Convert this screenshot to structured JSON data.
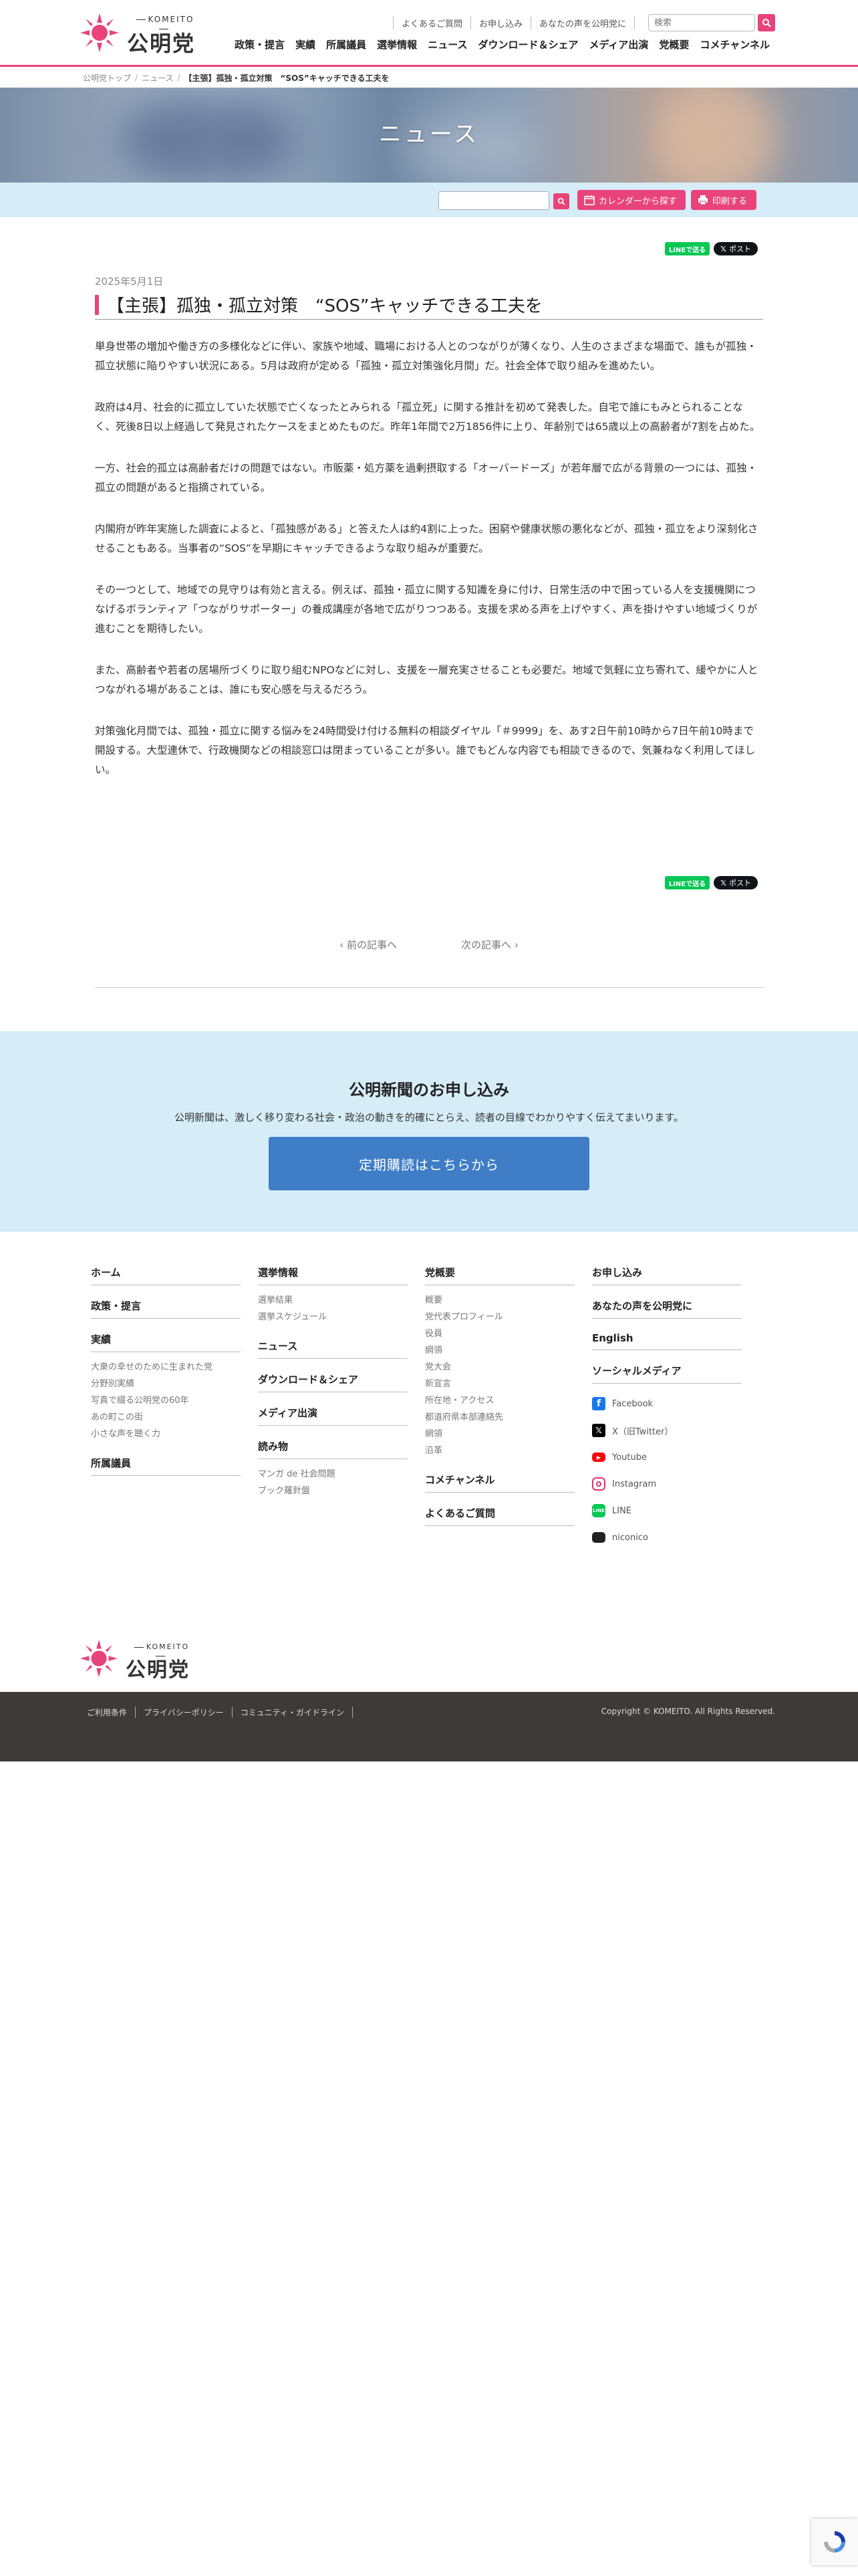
{
  "header": {
    "brand_en": "KOMEITO",
    "brand_ja": "公明党",
    "util_links": [
      "よくあるご質問",
      "お申し込み",
      "あなたの声を公明党に"
    ],
    "search_placeholder": "検索",
    "nav": [
      "政策・提言",
      "実績",
      "所属議員",
      "選挙情報",
      "ニュース",
      "ダウンロード＆シェア",
      "メディア出演",
      "党概要",
      "コメチャンネル"
    ]
  },
  "breadcrumb": {
    "home": "公明党トップ",
    "section": "ニュース",
    "current": "【主張】孤独・孤立対策　“SOS”キャッチできる工夫を"
  },
  "hero": {
    "title": "ニュース"
  },
  "toolbar": {
    "calendar_label": "カレンダーから探す",
    "print_label": "印刷する"
  },
  "share": {
    "line_label": "LINEで送る",
    "x_label": "ポスト"
  },
  "article": {
    "date": "2025年5月1日",
    "title": "【主張】孤独・孤立対策　“SOS”キャッチできる工夫を",
    "paragraphs": [
      "単身世帯の増加や働き方の多様化などに伴い、家族や地域、職場における人とのつながりが薄くなり、人生のさまざまな場面で、誰もが孤独・孤立状態に陥りやすい状況にある。5月は政府が定める「孤独・孤立対策強化月間」だ。社会全体で取り組みを進めたい。",
      "政府は4月、社会的に孤立していた状態で亡くなったとみられる「孤立死」に関する推計を初めて発表した。自宅で誰にもみとられることなく、死後8日以上経過して発見されたケースをまとめたものだ。昨年1年間で2万1856件に上り、年齢別では65歳以上の高齢者が7割を占めた。",
      "一方、社会的孤立は高齢者だけの問題ではない。市販薬・処方薬を過剰摂取する「オーバードーズ」が若年層で広がる背景の一つには、孤独・孤立の問題があると指摘されている。",
      "内閣府が昨年実施した調査によると、「孤独感がある」と答えた人は約4割に上った。困窮や健康状態の悪化などが、孤独・孤立をより深刻化させることもある。当事者の“SOS”を早期にキャッチできるような取り組みが重要だ。",
      "その一つとして、地域での見守りは有効と言える。例えば、孤独・孤立に関する知識を身に付け、日常生活の中で困っている人を支援機関につなげるボランティア「つながりサポーター」の養成講座が各地で広がりつつある。支援を求める声を上げやすく、声を掛けやすい地域づくりが進むことを期待したい。",
      "また、高齢者や若者の居場所づくりに取り組むNPOなどに対し、支援を一層充実させることも必要だ。地域で気軽に立ち寄れて、緩やかに人とつながれる場があることは、誰にも安心感を与えるだろう。",
      "対策強化月間では、孤独・孤立に関する悩みを24時間受け付ける無料の相談ダイヤル「＃9999」を、あす2日午前10時から7日午前10時まで開設する。大型連休で、行政機関などの相談窓口は閉まっていることが多い。誰でもどんな内容でも相談できるので、気兼ねなく利用してほしい。"
    ]
  },
  "pager": {
    "prev": "前の記事へ",
    "next": "次の記事へ"
  },
  "subscribe": {
    "title": "公明新聞のお申し込み",
    "description": "公明新聞は、激しく移り変わる社会・政治の動きを的確にとらえ、読者の目線でわかりやすく伝えてまいります。",
    "cta": "定期購読はこちらから"
  },
  "footer": {
    "col1": [
      {
        "head": "ホーム",
        "items": []
      },
      {
        "head": "政策・提言",
        "items": []
      },
      {
        "head": "実績",
        "items": [
          "大衆の幸せのために生まれた党",
          "分野別実績",
          "写真で綴る公明党の60年",
          "あの町この街",
          "小さな声を聴く力"
        ]
      },
      {
        "head": "所属議員",
        "items": []
      }
    ],
    "col2": [
      {
        "head": "選挙情報",
        "items": [
          "選挙結果",
          "選挙スケジュール"
        ]
      },
      {
        "head": "ニュース",
        "items": []
      },
      {
        "head": "ダウンロード＆シェア",
        "items": []
      },
      {
        "head": "メディア出演",
        "items": []
      },
      {
        "head": "読み物",
        "items": [
          "マンガ de 社会問題",
          "ブック羅針盤"
        ]
      }
    ],
    "col3": [
      {
        "head": "党概要",
        "items": [
          "概要",
          "党代表プロフィール",
          "役員",
          "綱領",
          "党大会",
          "新宣言",
          "所在地・アクセス",
          "都道府県本部連絡先",
          "網領",
          "沿革"
        ]
      },
      {
        "head": "コメチャンネル",
        "items": []
      },
      {
        "head": "よくあるご質問",
        "items": []
      }
    ],
    "col4": [
      {
        "head": "お申し込み",
        "items": []
      },
      {
        "head": "あなたの声を公明党に",
        "items": []
      },
      {
        "head": "English",
        "items": []
      }
    ],
    "social_head": "ソーシャルメディア",
    "social": [
      {
        "label": "Facebook",
        "icon": "facebook-icon",
        "color": "#1877f2"
      },
      {
        "label": "X（旧Twitter）",
        "icon": "x-icon",
        "color": "#000000"
      },
      {
        "label": "Youtube",
        "icon": "youtube-icon",
        "color": "#ff0000"
      },
      {
        "label": "Instagram",
        "icon": "instagram-icon",
        "color": "#e1306c"
      },
      {
        "label": "LINE",
        "icon": "line-icon",
        "color": "#06c755"
      },
      {
        "label": "niconico",
        "icon": "niconico-icon",
        "color": "#222222"
      }
    ],
    "legal_links": [
      "ご利用条件",
      "プライバシーポリシー",
      "コミュニティ・ガイドライン"
    ],
    "copyright": "Copyright © KOMEITO. All Rights Reserved."
  },
  "colors": {
    "accent": "#e8447a",
    "light_blue": "#d6edf8",
    "cta_blue": "#3f7dc6",
    "footer_dark": "#3d3a39"
  }
}
